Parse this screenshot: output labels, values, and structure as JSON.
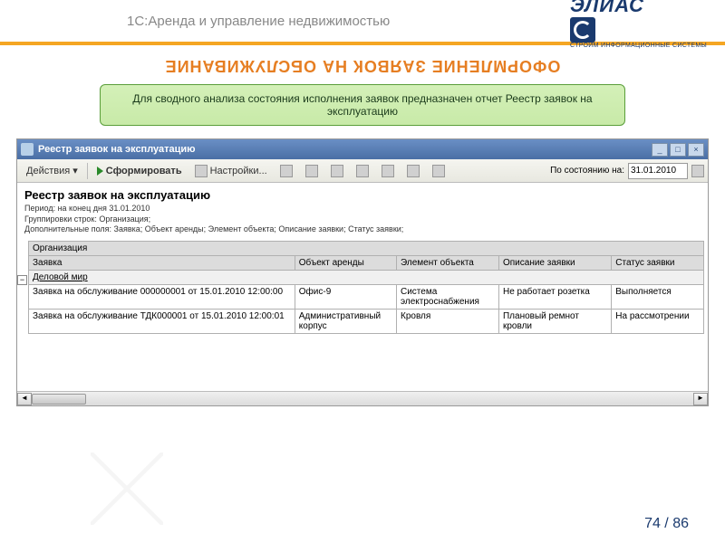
{
  "header": {
    "title": "1С:Аренда и управление недвижимостью",
    "logo_text": "ЭЛИАС",
    "logo_sub": "СТРОИМ ИНФОРМАЦИОННЫЕ СИСТЕМЫ"
  },
  "section_title": "ОФОРМЛЕНИЕ ЗАЯВОК НА ОБСЛУЖИВАНИЕ",
  "green_box": "Для сводного анализа состояния исполнения заявок предназначен отчет Реестр заявок на эксплуатацию",
  "window": {
    "title": "Реестр заявок на эксплуатацию",
    "toolbar": {
      "actions": "Действия ▾",
      "form": "Сформировать",
      "settings": "Настройки...",
      "as_of": "По состоянию на:",
      "date": "31.01.2010"
    },
    "report": {
      "title": "Реестр заявок на эксплуатацию",
      "meta1": "Период: на конец дня 31.01.2010",
      "meta2": "Группировки строк: Организация;",
      "meta3": "Дополнительные поля: Заявка; Объект аренды; Элемент объекта; Описание заявки; Статус заявки;"
    },
    "grid": {
      "header_org": "Организация",
      "header_req": "Заявка",
      "header_obj": "Объект аренды",
      "header_elem": "Элемент объекта",
      "header_desc": "Описание заявки",
      "header_stat": "Статус заявки",
      "group": "Деловой мир",
      "rows": [
        {
          "req": "Заявка на обслуживание 000000001 от 15.01.2010 12:00:00",
          "obj": "Офис-9",
          "elem": "Система электроснабжения",
          "desc": "Не работает розетка",
          "stat": "Выполняется"
        },
        {
          "req": "Заявка на обслуживание ТДК000001 от 15.01.2010 12:00:01",
          "obj": "Административный корпус",
          "elem": "Кровля",
          "desc": "Плановый ремнот кровли",
          "stat": "На рассмотрении"
        }
      ]
    }
  },
  "page": {
    "current": "74",
    "sep": " / ",
    "total": "86"
  }
}
